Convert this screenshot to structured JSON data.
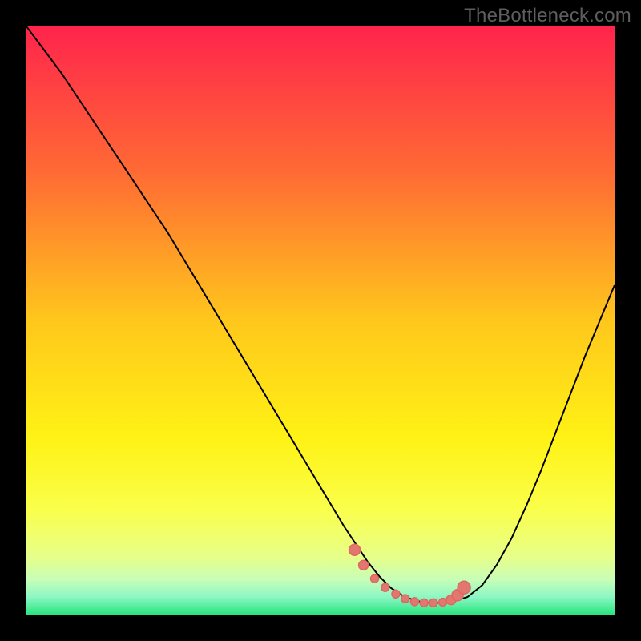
{
  "watermark": "TheBottleneck.com",
  "colors": {
    "background": "#000000",
    "watermark": "#5e5e5e",
    "curve": "#000000",
    "marker_fill": "#e2776f",
    "marker_stroke": "#de6861",
    "gradient_stops": [
      {
        "offset": 0.0,
        "color": "#ff244c"
      },
      {
        "offset": 0.25,
        "color": "#ff6b34"
      },
      {
        "offset": 0.5,
        "color": "#ffc71c"
      },
      {
        "offset": 0.7,
        "color": "#fff215"
      },
      {
        "offset": 0.82,
        "color": "#faff4a"
      },
      {
        "offset": 0.9,
        "color": "#e8ff87"
      },
      {
        "offset": 0.94,
        "color": "#c8feb7"
      },
      {
        "offset": 0.97,
        "color": "#8cf7c4"
      },
      {
        "offset": 1.0,
        "color": "#28e57e"
      }
    ]
  },
  "chart_data": {
    "type": "line",
    "title": "",
    "xlabel": "",
    "ylabel": "",
    "xlim": [
      0,
      100
    ],
    "ylim": [
      0,
      100
    ],
    "grid": false,
    "legend": null,
    "series": [
      {
        "name": "bottleneck-curve",
        "x": [
          0,
          3,
          6,
          9,
          12,
          15,
          18,
          21,
          24,
          27,
          30,
          33,
          36,
          39,
          42,
          45,
          48,
          51,
          54,
          56,
          58,
          60,
          62,
          64,
          66,
          68,
          70,
          72.5,
          75,
          77.5,
          80,
          82.5,
          85,
          87.5,
          90,
          92.5,
          95,
          97.5,
          100
        ],
        "y": [
          100,
          96,
          92,
          87.5,
          83,
          78.5,
          74,
          69.5,
          65,
          60,
          55,
          50,
          45,
          40,
          35,
          30,
          25,
          20,
          15,
          12,
          9,
          6.5,
          4.5,
          3.2,
          2.4,
          2.0,
          2.0,
          2.2,
          3.0,
          5.0,
          8.5,
          13,
          18.5,
          24.5,
          31,
          37.5,
          44,
          50,
          56
        ]
      }
    ],
    "markers": {
      "name": "highlight-band",
      "x": [
        55.8,
        57.3,
        59.2,
        61.0,
        62.8,
        64.4,
        66.0,
        67.6,
        69.2,
        70.8,
        72.2,
        73.3,
        74.4
      ],
      "y": [
        11.0,
        8.4,
        6.1,
        4.6,
        3.5,
        2.7,
        2.2,
        2.0,
        2.0,
        2.1,
        2.5,
        3.3,
        4.6
      ],
      "r": [
        7,
        6,
        5,
        5,
        5,
        5,
        5,
        5,
        5,
        5,
        6,
        7,
        8
      ]
    }
  }
}
